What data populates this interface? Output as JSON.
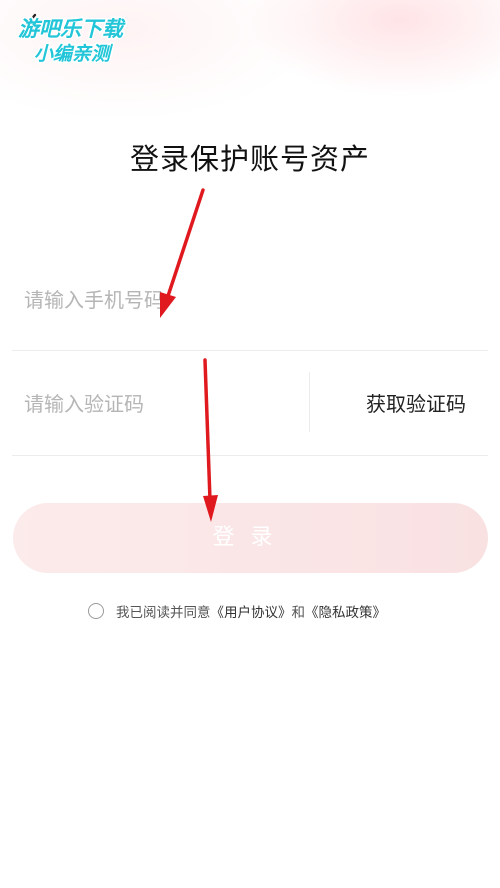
{
  "watermark": {
    "line1": "游吧乐下载",
    "line2": "小编亲测"
  },
  "header": {
    "title": "登录保护账号资产"
  },
  "form": {
    "phone_placeholder": "请输入手机号码",
    "code_placeholder": "请输入验证码",
    "get_code_label": "获取验证码",
    "login_label": "登录"
  },
  "agreement": {
    "prefix": "我已阅读并同意",
    "user_agreement": "《用户协议》",
    "and": "和",
    "privacy_policy": "《隐私政策》"
  },
  "colors": {
    "annotation_arrow": "#e0191f",
    "watermark_text": "#23c6d8",
    "login_button": "#fbe6e7"
  },
  "icons": {
    "back": "chevron-left-icon",
    "checkbox": "radio-circle-icon"
  }
}
